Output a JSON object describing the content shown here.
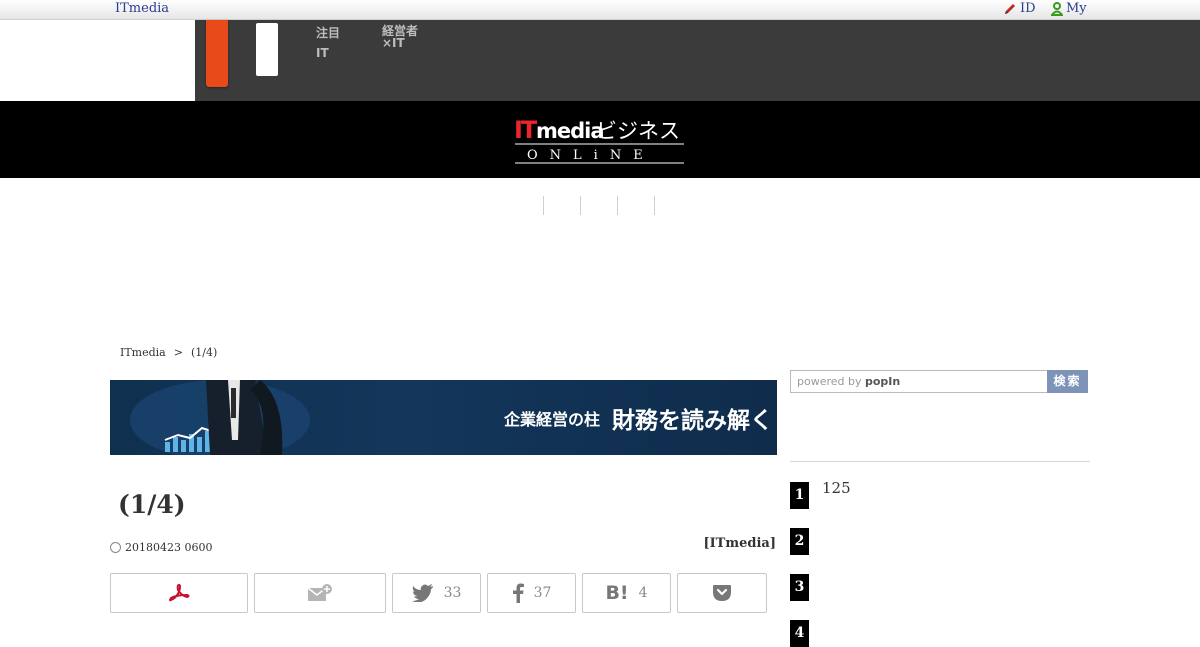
{
  "topbar": {
    "brand": "ITmedia",
    "id_label": "ID",
    "my_label": "My"
  },
  "nav": {
    "item1": [
      "注目",
      "IT"
    ],
    "item2": [
      "経営者",
      "×IT"
    ]
  },
  "logo": {
    "it": "IT",
    "media": "media",
    "business": "ビジネス",
    "online": "ONLiNE"
  },
  "breadcrumb": {
    "home": "ITmedia",
    "sep": ">",
    "current": "(1/4)"
  },
  "banner": {
    "small": "企業経営の柱",
    "big": "財務を読み解く"
  },
  "search": {
    "powered": "powered by",
    "popin": "popIn",
    "button": "検索"
  },
  "ranking": [
    {
      "rank": "1",
      "text": "125"
    },
    {
      "rank": "2",
      "text": ""
    },
    {
      "rank": "3",
      "text": ""
    },
    {
      "rank": "4",
      "text": ""
    }
  ],
  "article": {
    "title": "(1/4)",
    "date": "20180423 0600",
    "author": "[ITmedia]"
  },
  "share": {
    "twitter_count": "33",
    "facebook_count": "37",
    "hatena_count": "4"
  },
  "colors": {
    "nav_bg": "#3b3b3b",
    "accent_orange": "#e84a1a",
    "link_blue": "#2a3d8f",
    "search_button": "#7e93b8",
    "pdf_red": "#c8102e"
  }
}
